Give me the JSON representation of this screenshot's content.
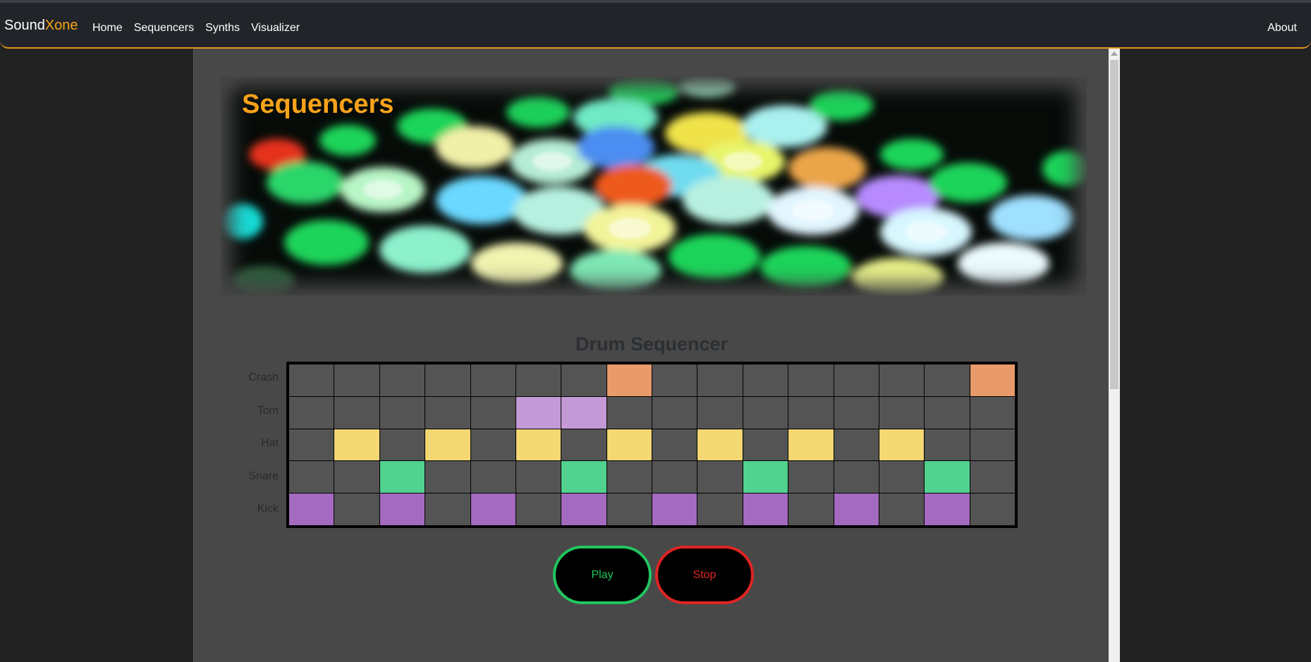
{
  "nav": {
    "brand_part1": "Sound",
    "brand_part2": "Xone",
    "links": [
      "Home",
      "Sequencers",
      "Synths",
      "Visualizer"
    ],
    "about": "About"
  },
  "hero": {
    "title": "Sequencers"
  },
  "sequencer": {
    "title": "Drum Sequencer",
    "rows": [
      {
        "label": "Crash",
        "color": "#e89a6a",
        "active": [
          7,
          15
        ]
      },
      {
        "label": "Tom",
        "color": "#c49ad6",
        "active": [
          5,
          6
        ]
      },
      {
        "label": "Hat",
        "color": "#f4d873",
        "active": [
          1,
          3,
          5,
          7,
          9,
          11,
          13
        ]
      },
      {
        "label": "Snare",
        "color": "#52d28f",
        "active": [
          2,
          6,
          10,
          14
        ]
      },
      {
        "label": "Kick",
        "color": "#a46ac0",
        "active": [
          0,
          2,
          4,
          6,
          8,
          10,
          12,
          14
        ]
      }
    ],
    "steps": 16
  },
  "controls": {
    "play": "Play",
    "stop": "Stop"
  },
  "colors": {
    "accent": "#f7a21a",
    "play": "#22c55e",
    "stop": "#e02424"
  }
}
